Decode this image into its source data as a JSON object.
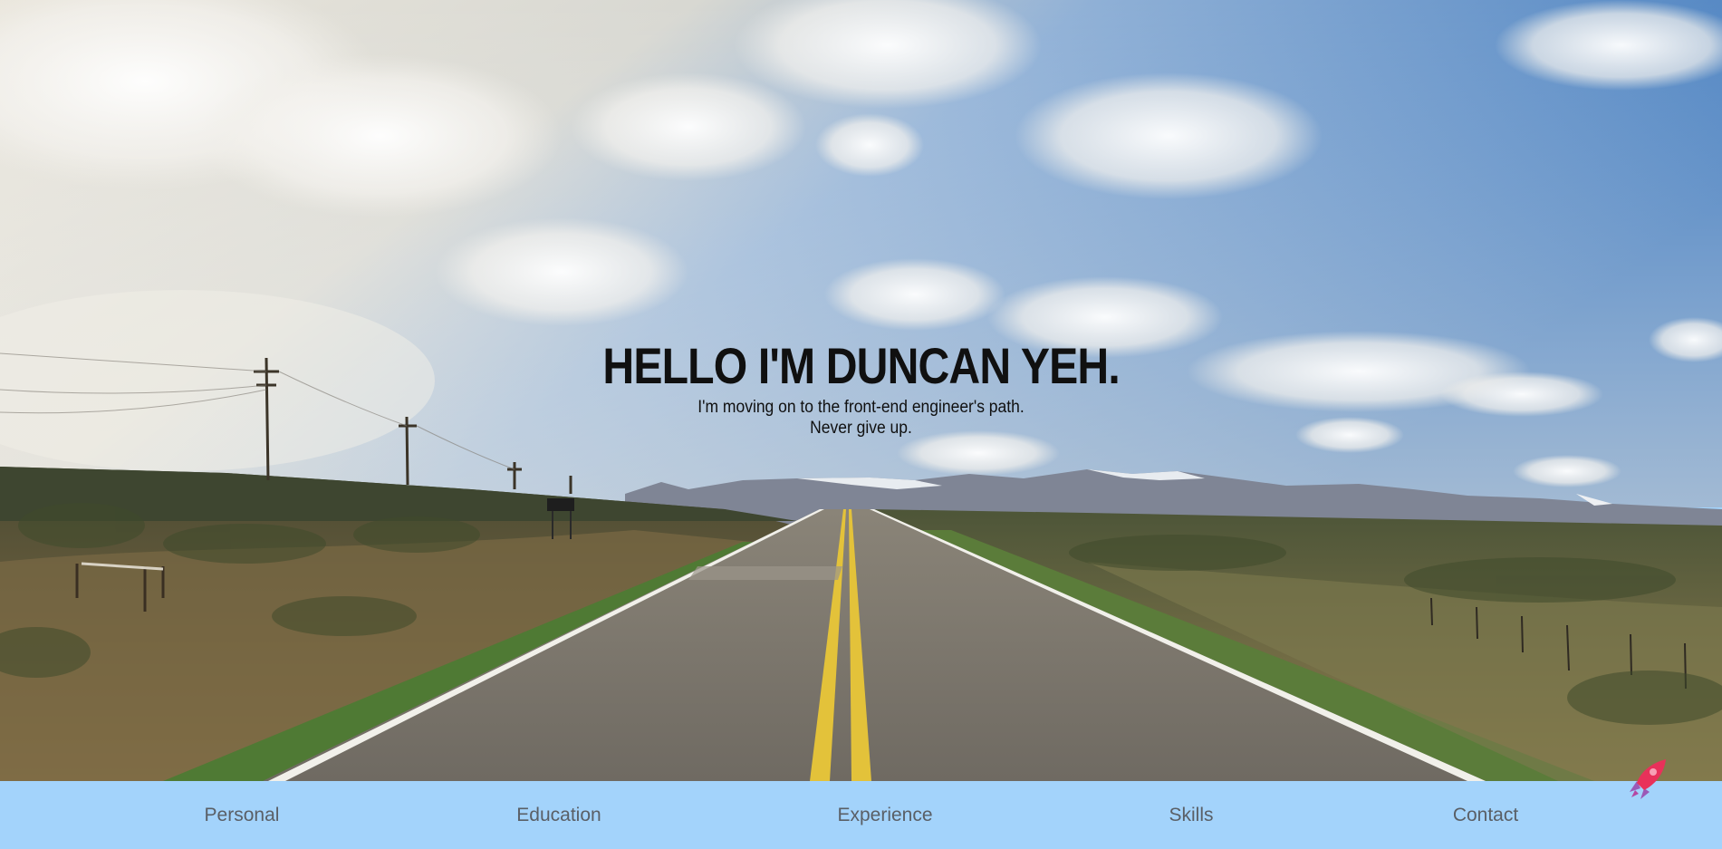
{
  "hero": {
    "heading": "HELLO I'M DUNCAN YEH.",
    "subtitle_line1": "I'm moving on to the front-end engineer's path.",
    "subtitle_line2": "Never give up."
  },
  "nav": {
    "items": [
      {
        "label": "Personal"
      },
      {
        "label": "Education"
      },
      {
        "label": "Experience"
      },
      {
        "label": "Skills"
      },
      {
        "label": "Contact"
      }
    ]
  },
  "colors": {
    "nav_background": "#a3d3fb",
    "nav_text": "#5a5f66",
    "heading_text": "#101010",
    "rocket_body": "#e8315a",
    "rocket_fin": "#9b59b6"
  },
  "icons": {
    "back_to_top": "rocket-icon"
  }
}
